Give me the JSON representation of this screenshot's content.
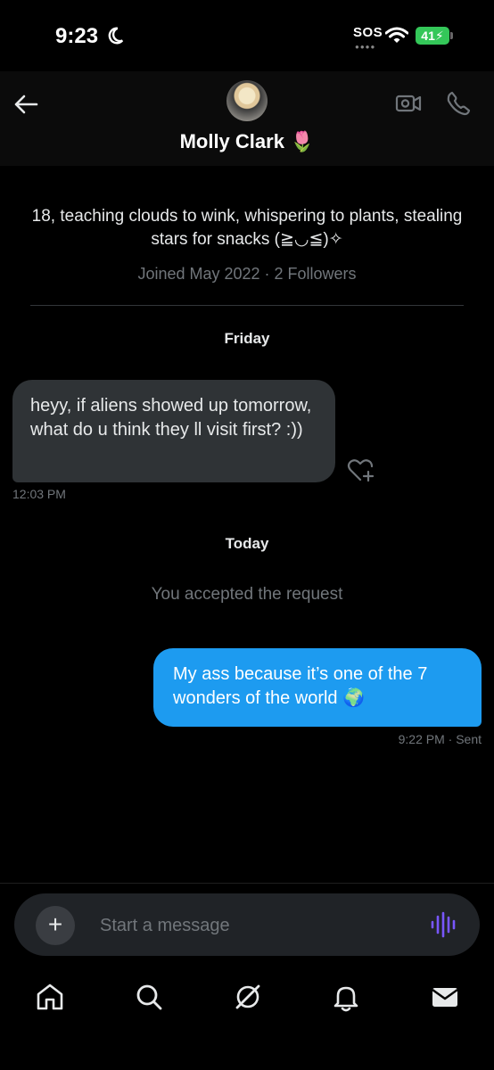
{
  "status_bar": {
    "time": "9:23",
    "sos": "SOS",
    "battery": "41"
  },
  "header": {
    "name": "Molly Clark 🌷"
  },
  "profile": {
    "bio": "18, teaching clouds to wink, whispering to plants, stealing stars for snacks (≧◡≦)✧",
    "joined": "Joined May 2022 · 2 Followers"
  },
  "conversation": {
    "day1": "Friday",
    "incoming_message": "heyy, if aliens showed up tomorrow, what do u think they ll visit first? :))",
    "incoming_time": "12:03 PM",
    "day2": "Today",
    "system_message": "You accepted the request",
    "outgoing_message": "My ass because it’s one of the 7 wonders of the world 🌍",
    "outgoing_time": "9:22 PM · Sent"
  },
  "composer": {
    "placeholder": "Start a message"
  },
  "nav": {
    "items": [
      "home-icon",
      "search-icon",
      "grok-icon",
      "notifications-icon",
      "messages-icon"
    ]
  },
  "colors": {
    "accent": "#1d9bf0",
    "voice": "#7856ff",
    "battery": "#34c759"
  }
}
